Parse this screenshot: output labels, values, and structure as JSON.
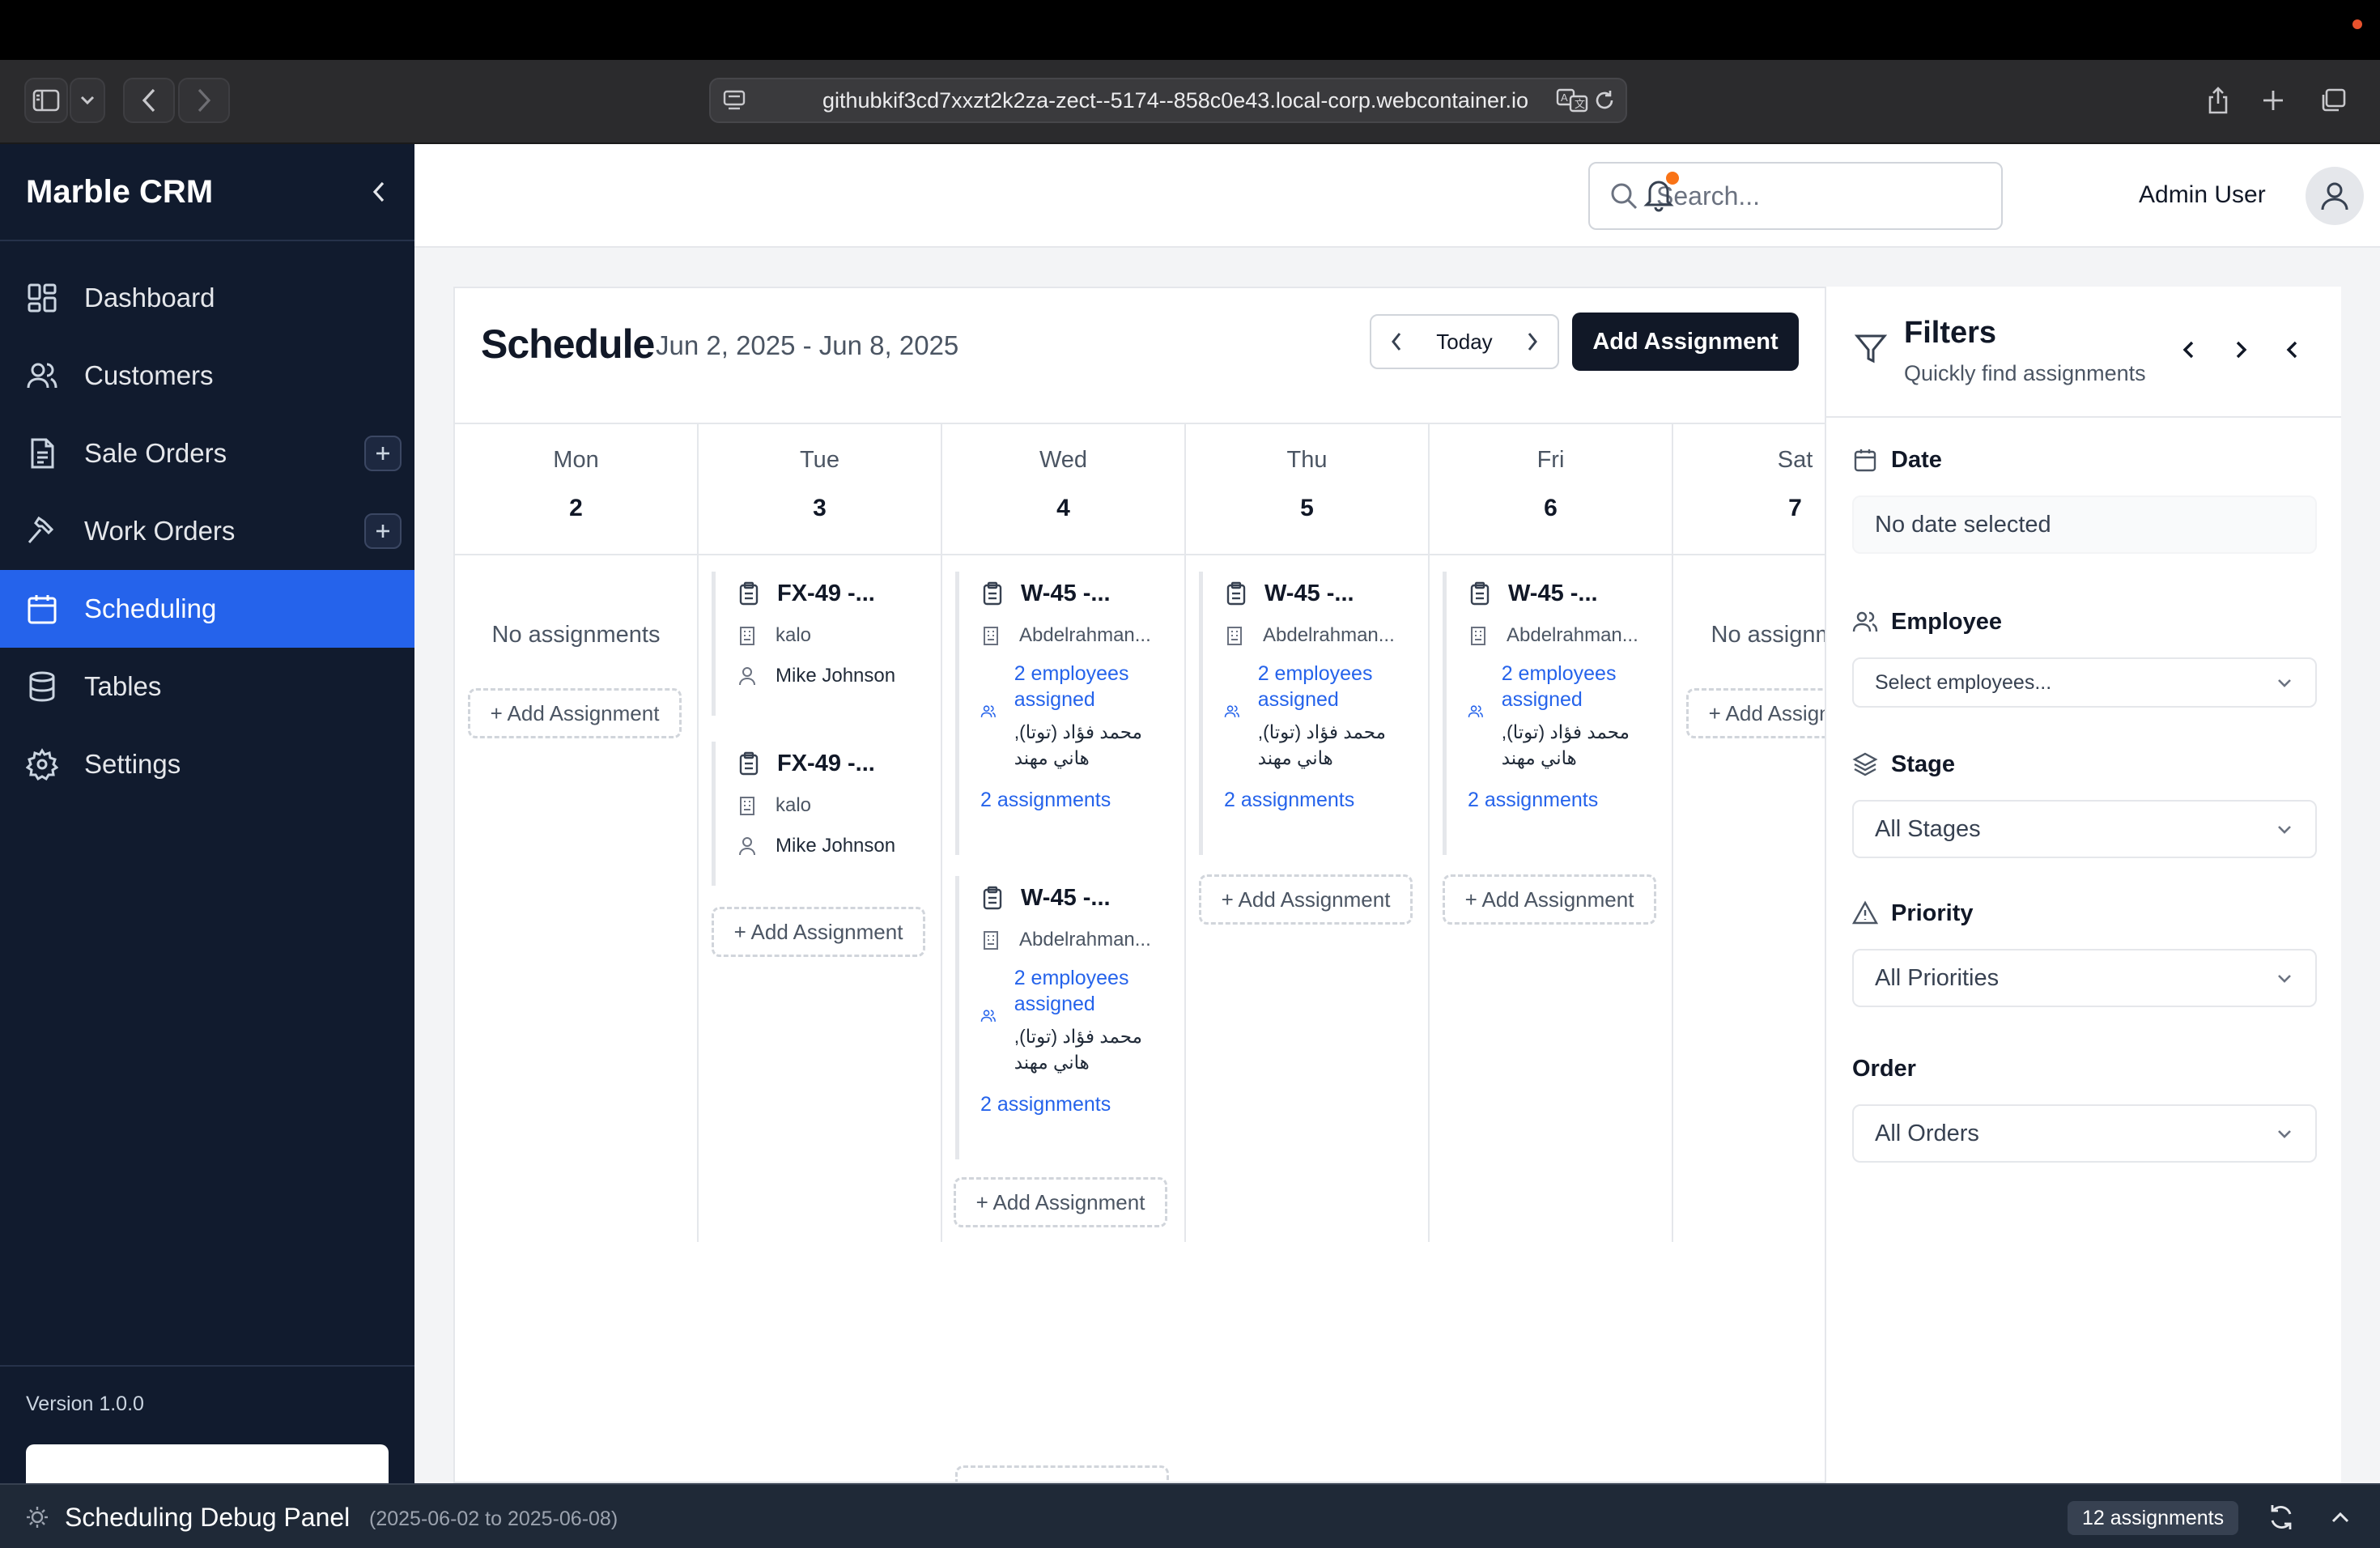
{
  "browser": {
    "url": "githubkif3cd7xxzt2k2za-zect--5174--858c0e43.local-corp.webcontainer.io"
  },
  "sidebar": {
    "brand": "Marble CRM",
    "items": [
      {
        "label": "Dashboard",
        "icon": "dashboard-icon"
      },
      {
        "label": "Customers",
        "icon": "users-icon"
      },
      {
        "label": "Sale Orders",
        "icon": "document-icon"
      },
      {
        "label": "Work Orders",
        "icon": "hammer-icon"
      },
      {
        "label": "Scheduling",
        "icon": "calendar-icon",
        "active": true
      },
      {
        "label": "Tables",
        "icon": "database-icon"
      },
      {
        "label": "Settings",
        "icon": "gear-icon"
      }
    ],
    "version": "Version 1.0.0"
  },
  "topbar": {
    "search_placeholder": "Search...",
    "user_name": "Admin User"
  },
  "schedule": {
    "title": "Schedule",
    "range": "Jun 2, 2025 - Jun 8, 2025",
    "today_label": "Today",
    "add_label": "Add Assignment",
    "no_assignments": "No assignments",
    "add_day_label": "+ Add Assignment",
    "days": [
      {
        "name": "Mon",
        "num": "2"
      },
      {
        "name": "Tue",
        "num": "3"
      },
      {
        "name": "Wed",
        "num": "4"
      },
      {
        "name": "Thu",
        "num": "5"
      },
      {
        "name": "Fri",
        "num": "6"
      },
      {
        "name": "Sat",
        "num": "7"
      }
    ],
    "cards": {
      "tue1": {
        "title": "FX-49 -...",
        "customer": "kalo",
        "employee": "Mike Johnson"
      },
      "tue2": {
        "title": "FX-49 -...",
        "customer": "kalo",
        "employee": "Mike Johnson"
      },
      "wed1": {
        "title": "W-45 -...",
        "customer": "Abdelrahman...",
        "emp_link": "2 employees assigned",
        "names": "محمد فؤاد (توتا), هاني مهند",
        "count": "2 assignments"
      },
      "wed2": {
        "title": "W-45 -...",
        "customer": "Abdelrahman...",
        "emp_link": "2 employees assigned",
        "names": "محمد فؤاد (توتا), هاني مهند",
        "count": "2 assignments"
      },
      "thu1": {
        "title": "W-45 -...",
        "customer": "Abdelrahman...",
        "emp_link": "2 employees assigned",
        "names": "محمد فؤاد (توتا), هاني مهند",
        "count": "2 assignments"
      },
      "fri1": {
        "title": "W-45 -...",
        "customer": "Abdelrahman...",
        "emp_link": "2 employees assigned",
        "names": "محمد فؤاد (توتا), هاني مهند",
        "count": "2 assignments"
      }
    }
  },
  "filters": {
    "title": "Filters",
    "subtitle": "Quickly find assignments",
    "date_label": "Date",
    "date_value": "No date selected",
    "employee_label": "Employee",
    "employee_placeholder": "Select employees...",
    "stage_label": "Stage",
    "stage_value": "All Stages",
    "priority_label": "Priority",
    "priority_value": "All Priorities",
    "order_label": "Order",
    "order_value": "All Orders"
  },
  "debug": {
    "title": "Scheduling Debug Panel",
    "range": "(2025-06-02 to 2025-06-08)",
    "badge": "12 assignments"
  }
}
